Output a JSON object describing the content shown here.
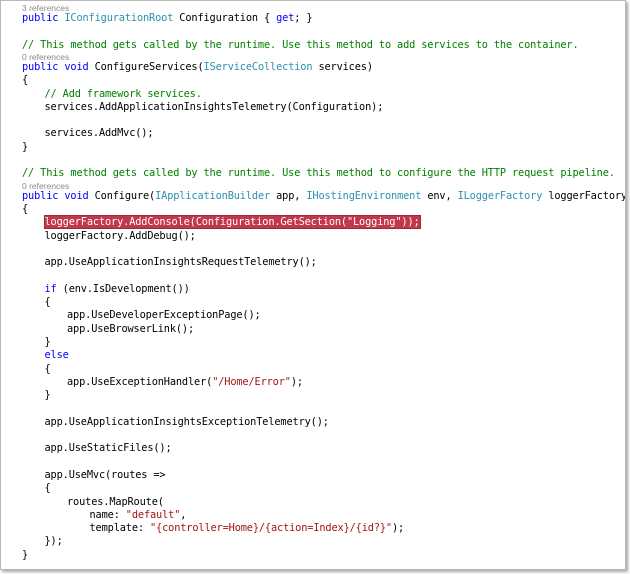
{
  "code_lines": [
    {
      "kind": "ref",
      "indent": 1,
      "tokens": [
        {
          "t": "3 references"
        }
      ]
    },
    {
      "kind": "code",
      "indent": 1,
      "tokens": [
        {
          "t": "public",
          "c": "kw"
        },
        {
          "t": " "
        },
        {
          "t": "IConfigurationRoot",
          "c": "ty"
        },
        {
          "t": " Configuration { "
        },
        {
          "t": "get",
          "c": "kw"
        },
        {
          "t": "; }"
        }
      ]
    },
    {
      "kind": "blank",
      "tokens": []
    },
    {
      "kind": "code",
      "indent": 1,
      "tokens": [
        {
          "t": "// This method gets called by the runtime. Use this method to add services to the container.",
          "c": "cm"
        }
      ]
    },
    {
      "kind": "ref",
      "indent": 1,
      "tokens": [
        {
          "t": "0 references"
        }
      ]
    },
    {
      "kind": "code",
      "indent": 1,
      "tokens": [
        {
          "t": "public",
          "c": "kw"
        },
        {
          "t": " "
        },
        {
          "t": "void",
          "c": "kw"
        },
        {
          "t": " ConfigureServices("
        },
        {
          "t": "IServiceCollection",
          "c": "ty"
        },
        {
          "t": " services)"
        }
      ]
    },
    {
      "kind": "code",
      "indent": 1,
      "tokens": [
        {
          "t": "{"
        }
      ]
    },
    {
      "kind": "code",
      "indent": 2,
      "tokens": [
        {
          "t": "// Add framework services.",
          "c": "cm"
        }
      ]
    },
    {
      "kind": "code",
      "indent": 2,
      "tokens": [
        {
          "t": "services.AddApplicationInsightsTelemetry(Configuration);"
        }
      ]
    },
    {
      "kind": "blank",
      "tokens": []
    },
    {
      "kind": "code",
      "indent": 2,
      "tokens": [
        {
          "t": "services.AddMvc();"
        }
      ]
    },
    {
      "kind": "code",
      "indent": 1,
      "tokens": [
        {
          "t": "}"
        }
      ]
    },
    {
      "kind": "blank",
      "tokens": []
    },
    {
      "kind": "code",
      "indent": 1,
      "tokens": [
        {
          "t": "// This method gets called by the runtime. Use this method to configure the HTTP request pipeline.",
          "c": "cm"
        }
      ]
    },
    {
      "kind": "ref",
      "indent": 1,
      "tokens": [
        {
          "t": "0 references"
        }
      ]
    },
    {
      "kind": "code",
      "indent": 1,
      "tokens": [
        {
          "t": "public",
          "c": "kw"
        },
        {
          "t": " "
        },
        {
          "t": "void",
          "c": "kw"
        },
        {
          "t": " Configure("
        },
        {
          "t": "IApplicationBuilder",
          "c": "ty"
        },
        {
          "t": " app, "
        },
        {
          "t": "IHostingEnvironment",
          "c": "ty"
        },
        {
          "t": " env, "
        },
        {
          "t": "ILoggerFactory",
          "c": "ty"
        },
        {
          "t": " loggerFactory)"
        }
      ]
    },
    {
      "kind": "code",
      "indent": 1,
      "tokens": [
        {
          "t": "{"
        }
      ]
    },
    {
      "kind": "code",
      "indent": 2,
      "highlight": true,
      "tokens": [
        {
          "t": "loggerFactory.AddConsole(Configuration.GetSection(\"Logging\"));"
        }
      ]
    },
    {
      "kind": "code",
      "indent": 2,
      "tokens": [
        {
          "t": "loggerFactory.AddDebug();"
        }
      ]
    },
    {
      "kind": "blank",
      "tokens": []
    },
    {
      "kind": "code",
      "indent": 2,
      "tokens": [
        {
          "t": "app.UseApplicationInsightsRequestTelemetry();"
        }
      ]
    },
    {
      "kind": "blank",
      "tokens": []
    },
    {
      "kind": "code",
      "indent": 2,
      "tokens": [
        {
          "t": "if",
          "c": "kw"
        },
        {
          "t": " (env.IsDevelopment())"
        }
      ]
    },
    {
      "kind": "code",
      "indent": 2,
      "tokens": [
        {
          "t": "{"
        }
      ]
    },
    {
      "kind": "code",
      "indent": 3,
      "tokens": [
        {
          "t": "app.UseDeveloperExceptionPage();"
        }
      ]
    },
    {
      "kind": "code",
      "indent": 3,
      "tokens": [
        {
          "t": "app.UseBrowserLink();"
        }
      ]
    },
    {
      "kind": "code",
      "indent": 2,
      "tokens": [
        {
          "t": "}"
        }
      ]
    },
    {
      "kind": "code",
      "indent": 2,
      "tokens": [
        {
          "t": "else",
          "c": "kw"
        }
      ]
    },
    {
      "kind": "code",
      "indent": 2,
      "tokens": [
        {
          "t": "{"
        }
      ]
    },
    {
      "kind": "code",
      "indent": 3,
      "tokens": [
        {
          "t": "app.UseExceptionHandler("
        },
        {
          "t": "\"/Home/Error\"",
          "c": "st"
        },
        {
          "t": ");"
        }
      ]
    },
    {
      "kind": "code",
      "indent": 2,
      "tokens": [
        {
          "t": "}"
        }
      ]
    },
    {
      "kind": "blank",
      "tokens": []
    },
    {
      "kind": "code",
      "indent": 2,
      "tokens": [
        {
          "t": "app.UseApplicationInsightsExceptionTelemetry();"
        }
      ]
    },
    {
      "kind": "blank",
      "tokens": []
    },
    {
      "kind": "code",
      "indent": 2,
      "tokens": [
        {
          "t": "app.UseStaticFiles();"
        }
      ]
    },
    {
      "kind": "blank",
      "tokens": []
    },
    {
      "kind": "code",
      "indent": 2,
      "tokens": [
        {
          "t": "app.UseMvc(routes =>"
        }
      ]
    },
    {
      "kind": "code",
      "indent": 2,
      "tokens": [
        {
          "t": "{"
        }
      ]
    },
    {
      "kind": "code",
      "indent": 3,
      "tokens": [
        {
          "t": "routes.MapRoute("
        }
      ]
    },
    {
      "kind": "code",
      "indent": 4,
      "tokens": [
        {
          "t": "name: "
        },
        {
          "t": "\"default\"",
          "c": "st"
        },
        {
          "t": ","
        }
      ]
    },
    {
      "kind": "code",
      "indent": 4,
      "tokens": [
        {
          "t": "template: "
        },
        {
          "t": "\"{controller=Home}/{action=Index}/{id?}\"",
          "c": "st"
        },
        {
          "t": ");"
        }
      ]
    },
    {
      "kind": "code",
      "indent": 2,
      "tokens": [
        {
          "t": "});"
        }
      ]
    },
    {
      "kind": "code",
      "indent": 1,
      "tokens": [
        {
          "t": "}"
        }
      ]
    }
  ],
  "colors": {
    "keyword": "#0000ff",
    "type": "#2b91af",
    "comment": "#008000",
    "string": "#a31515",
    "reference_lens": "#8a8a8a",
    "highlight_bg": "#c0384a"
  }
}
